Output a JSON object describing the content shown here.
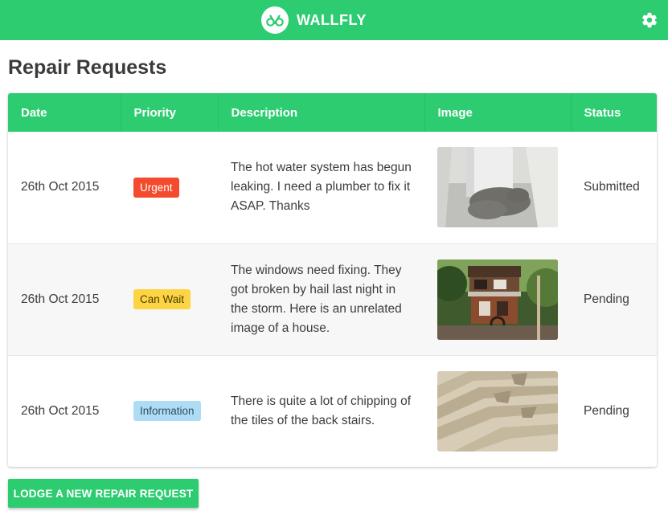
{
  "header": {
    "app_name": "WALLFLY",
    "logo_icon": "wallfly-logo-icon",
    "settings_icon": "gear-icon",
    "color": "#2ecc71"
  },
  "page": {
    "title": "Repair Requests"
  },
  "table": {
    "columns": [
      "Date",
      "Priority",
      "Description",
      "Image",
      "Status"
    ],
    "rows": [
      {
        "date": "26th Oct 2015",
        "priority": "Urgent",
        "priority_color": "#f44b2f",
        "description": "The hot water system has begun leaking. I need a plumber to fix it ASAP. Thanks",
        "image": "leaking-hot-water-system-photo",
        "status": "Submitted"
      },
      {
        "date": "26th Oct 2015",
        "priority": "Can Wait",
        "priority_color": "#fdd444",
        "description": "The windows need fixing. They got broken by hail last night in the storm. Here is an unrelated image of a house.",
        "image": "house-photo",
        "status": "Pending"
      },
      {
        "date": "26th Oct 2015",
        "priority": "Information",
        "priority_color": "#aedcf5",
        "description": "There is quite a lot of chipping of the tiles of the back stairs.",
        "image": "chipped-stairs-photo",
        "status": "Pending"
      }
    ]
  },
  "actions": {
    "lodge_label": "LODGE A NEW REPAIR REQUEST"
  }
}
